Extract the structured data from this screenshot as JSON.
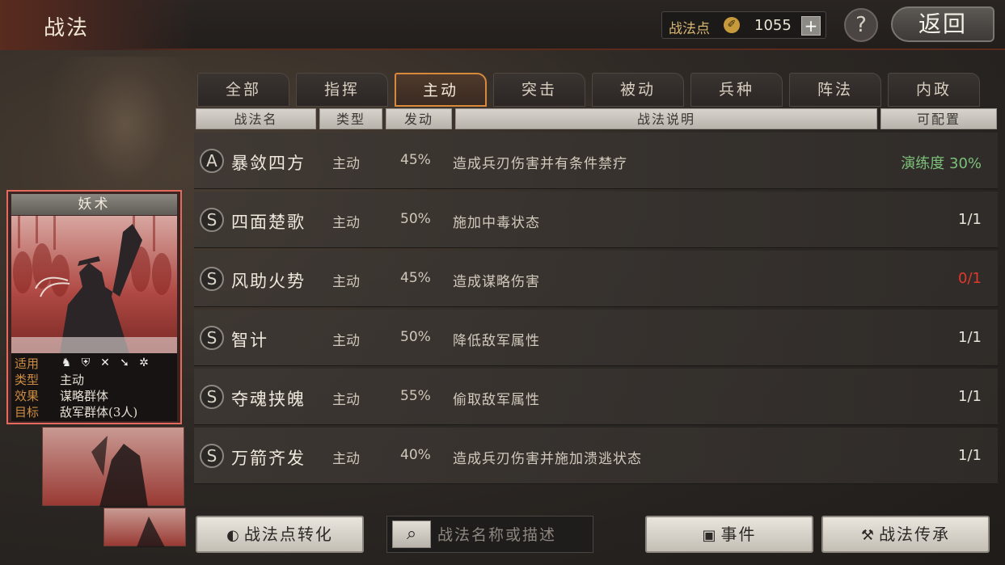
{
  "header": {
    "title": "战法",
    "points_label": "战法点",
    "points_value": "1055",
    "add_symbol": "+",
    "help_symbol": "?",
    "back_label": "返回"
  },
  "tabs": [
    {
      "label": "全部",
      "active": false
    },
    {
      "label": "指挥",
      "active": false
    },
    {
      "label": "主动",
      "active": true
    },
    {
      "label": "突击",
      "active": false
    },
    {
      "label": "被动",
      "active": false
    },
    {
      "label": "兵种",
      "active": false
    },
    {
      "label": "阵法",
      "active": false
    },
    {
      "label": "内政",
      "active": false
    }
  ],
  "columns": {
    "name": "战法名",
    "type": "类型",
    "rate": "发动",
    "desc": "战法说明",
    "avail": "可配置"
  },
  "skills": [
    {
      "grade": "A",
      "name": "暴敛四方",
      "type": "主动",
      "rate": "45%",
      "desc": "造成兵刃伤害并有条件禁疗",
      "avail": "演练度 30%",
      "avail_color": "#7cc07a"
    },
    {
      "grade": "S",
      "name": "四面楚歌",
      "type": "主动",
      "rate": "50%",
      "desc": "施加中毒状态",
      "avail": "1/1",
      "avail_color": "#e9e3d8"
    },
    {
      "grade": "S",
      "name": "风助火势",
      "type": "主动",
      "rate": "45%",
      "desc": "造成谋略伤害",
      "avail": "0/1",
      "avail_color": "#e0392b"
    },
    {
      "grade": "S",
      "name": "智计",
      "type": "主动",
      "rate": "50%",
      "desc": "降低敌军属性",
      "avail": "1/1",
      "avail_color": "#e9e3d8"
    },
    {
      "grade": "S",
      "name": "夺魂挟魄",
      "type": "主动",
      "rate": "55%",
      "desc": "偷取敌军属性",
      "avail": "1/1",
      "avail_color": "#e9e3d8"
    },
    {
      "grade": "S",
      "name": "万箭齐发",
      "type": "主动",
      "rate": "40%",
      "desc": "造成兵刃伤害并施加溃逃状态",
      "avail": "1/1",
      "avail_color": "#e9e3d8"
    }
  ],
  "card": {
    "title": "妖术",
    "apply_key": "适用",
    "type_key": "类型",
    "type_val": "主动",
    "effect_key": "效果",
    "effect_val": "谋略群体",
    "target_key": "目标",
    "target_val": "敌军群体(3人)",
    "unit_icons": [
      "cavalry-icon",
      "shield-icon",
      "bow-icon",
      "spear-icon",
      "wheel-icon"
    ]
  },
  "footer": {
    "convert_label": "战法点转化",
    "search_placeholder": "战法名称或描述",
    "event_label": "事件",
    "inherit_label": "战法传承"
  },
  "colors": {
    "accent_tab": "#d88a3c",
    "card_border": "#e36a5c",
    "label_gold": "#cd8c42"
  }
}
